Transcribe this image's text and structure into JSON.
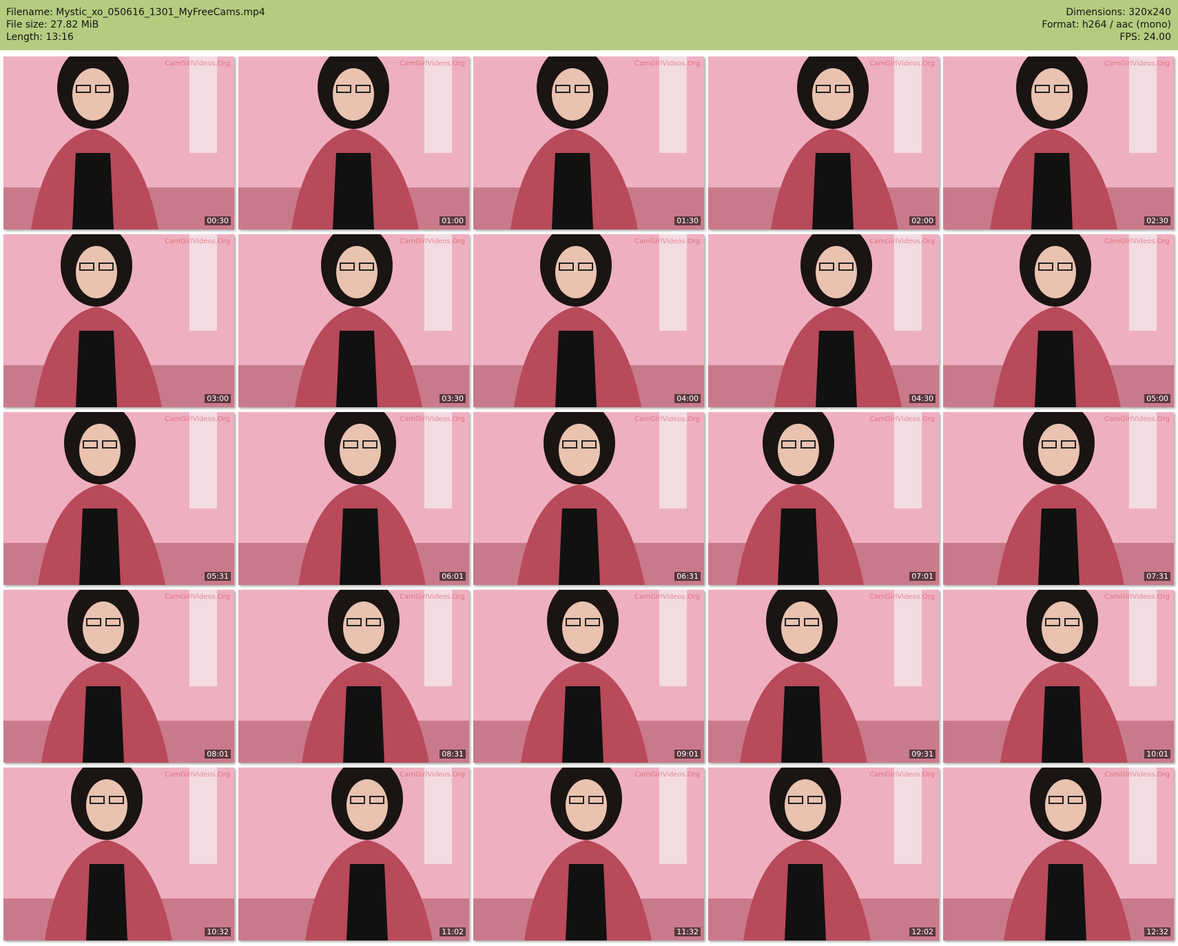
{
  "header": {
    "filename_line": "Filename: Mystic_xo_050616_1301_MyFreeCams.mp4",
    "filesize_line": "File size: 27.82 MiB",
    "length_line": "Length: 13:16",
    "dimensions_line": "Dimensions: 320x240",
    "format_line": "Format: h264 / aac (mono)",
    "fps_line": "FPS: 24.00"
  },
  "colors": {
    "header_bg": "#b3cc80",
    "wall_pink": "#eeb0c0",
    "blanket_red": "#b84a5a",
    "shirt_black": "#111111"
  },
  "watermark": "CamGirlVideos.Org",
  "thumbnails": [
    {
      "time": "00:30"
    },
    {
      "time": "01:00"
    },
    {
      "time": "01:30"
    },
    {
      "time": "02:00"
    },
    {
      "time": "02:30"
    },
    {
      "time": "03:00"
    },
    {
      "time": "03:30"
    },
    {
      "time": "04:00"
    },
    {
      "time": "04:30"
    },
    {
      "time": "05:00"
    },
    {
      "time": "05:31"
    },
    {
      "time": "06:01"
    },
    {
      "time": "06:31"
    },
    {
      "time": "07:01"
    },
    {
      "time": "07:31"
    },
    {
      "time": "08:01"
    },
    {
      "time": "08:31"
    },
    {
      "time": "09:01"
    },
    {
      "time": "09:31"
    },
    {
      "time": "10:01"
    },
    {
      "time": "10:32"
    },
    {
      "time": "11:02"
    },
    {
      "time": "11:32"
    },
    {
      "time": "12:02"
    },
    {
      "time": "12:32"
    }
  ]
}
